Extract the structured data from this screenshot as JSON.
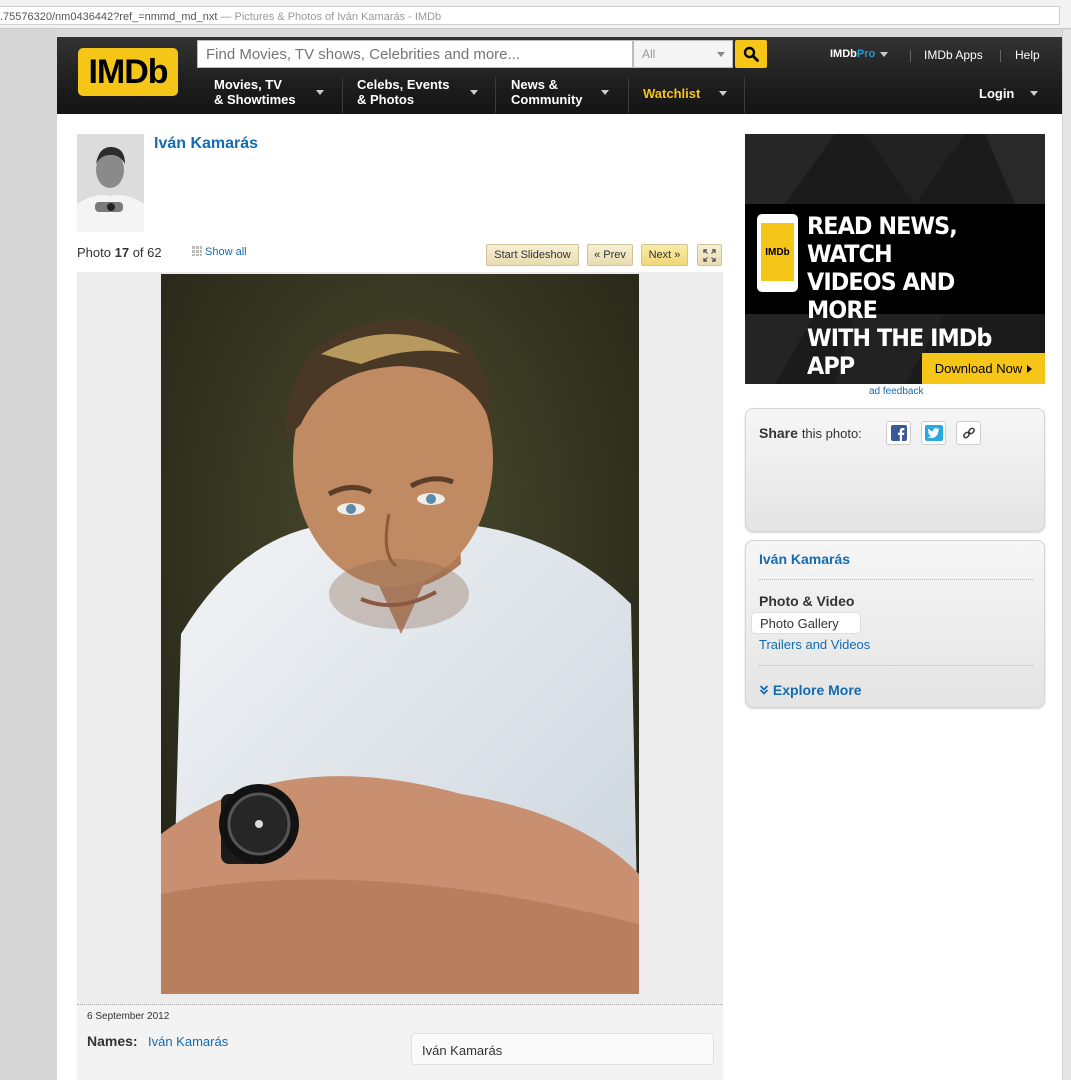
{
  "browser": {
    "url": ".75576320/nm0436442?ref_=nmmd_md_nxt",
    "tab_title": " — Pictures & Photos of Iván Kamarás - IMDb"
  },
  "header": {
    "logo": "IMDb",
    "search_placeholder": "Find Movies, TV shows, Celebrities and more...",
    "search_category": "All",
    "imdbpro_left": "IMDb",
    "imdbpro_right": "Pro",
    "apps": "IMDb Apps",
    "help": "Help",
    "nav": {
      "movies_l1": "Movies, TV",
      "movies_l2": "& Showtimes",
      "celebs_l1": "Celebs, Events",
      "celebs_l2": "& Photos",
      "news_l1": "News &",
      "news_l2": "Community",
      "watchlist": "Watchlist",
      "login": "Login"
    }
  },
  "person": {
    "name": "Iván Kamarás"
  },
  "gallery": {
    "photo_prefix": "Photo",
    "current": "17",
    "of": "of",
    "total": "62",
    "show_all": "Show all",
    "start_slideshow": "Start Slideshow",
    "prev": "« Prev",
    "next": "Next »"
  },
  "caption": {
    "date": "6 September 2012",
    "names_label": "Names:",
    "names_value": "Iván Kamarás",
    "name_box": "Iván Kamarás"
  },
  "ad": {
    "phone_logo": "IMDb",
    "line1": "READ NEWS, WATCH",
    "line2": "VIDEOS AND MORE",
    "line3": "WITH THE IMDb APP",
    "download": "Download Now",
    "feedback": "ad feedback"
  },
  "share": {
    "label_bold": "Share",
    "label_rest": "this photo:"
  },
  "side_links": {
    "name": "Iván Kamarás",
    "section": "Photo & Video",
    "gallery": "Photo Gallery",
    "trailers": "Trailers and Videos",
    "explore": "Explore More"
  },
  "colors": {
    "imdb_yellow": "#f5c518",
    "link_blue": "#136cb2",
    "header_dark": "#1e1e1e"
  }
}
